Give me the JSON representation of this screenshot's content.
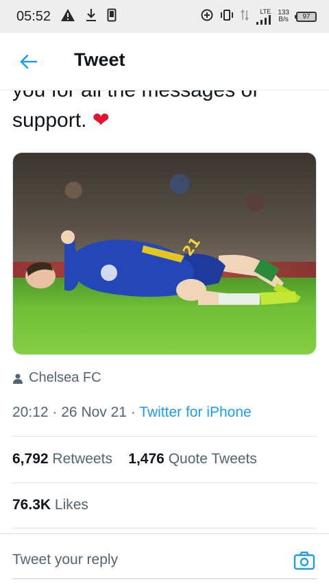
{
  "status_bar": {
    "time": "05:52",
    "network_type": "LTE",
    "data_rate_value": "133",
    "data_rate_unit": "B/s",
    "battery": "97",
    "icons": [
      "warning-icon",
      "download-icon",
      "phone-icon",
      "add-circle-icon",
      "vibrate-icon",
      "data-arrows-icon",
      "signal-icon"
    ]
  },
  "header": {
    "title": "Tweet"
  },
  "tweet": {
    "text_line1": "you for all the messages of",
    "text_line2": "support.",
    "emoji": "❤",
    "author": "Chelsea FC",
    "time": "20:12",
    "separator": "·",
    "date": "26 Nov 21",
    "source": "Twitter for iPhone",
    "retweets_count": "6,792",
    "retweets_label": "Retweets",
    "quote_count": "1,476",
    "quote_label": "Quote Tweets",
    "likes_count": "76.3K",
    "likes_label": "Likes",
    "image_jersey_number": "21"
  },
  "reply": {
    "placeholder": "Tweet your reply"
  },
  "colors": {
    "accent": "#1d9bf0",
    "heart": "#e0142a",
    "muted": "#536471"
  }
}
